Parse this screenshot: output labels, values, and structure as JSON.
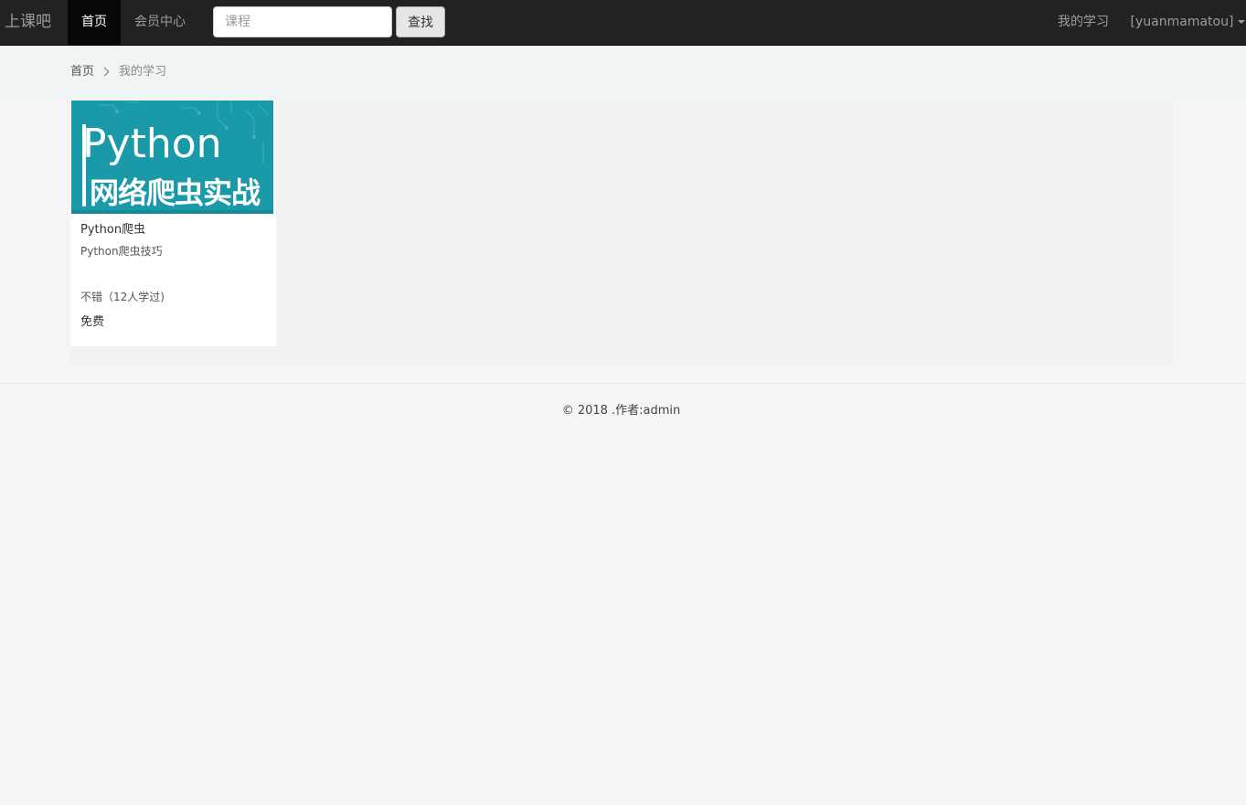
{
  "navbar": {
    "brand": "上课吧",
    "items": [
      {
        "label": "首页",
        "active": true
      },
      {
        "label": "会员中心",
        "active": false
      }
    ],
    "search": {
      "placeholder": "课程",
      "value": "",
      "button_label": "查找"
    },
    "right": {
      "my_learning": "我的学习",
      "user_menu": "[yuanmamatou]"
    }
  },
  "breadcrumb": {
    "home": "首页",
    "current": "我的学习"
  },
  "courses": [
    {
      "cover_title": "Python",
      "cover_subtitle": "网络爬虫实战",
      "name": "Python爬虫",
      "description": "Python爬虫技巧",
      "rating": "不错（12人学过)",
      "price": "免费"
    }
  ],
  "footer": {
    "text": "© 2018 .作者:admin"
  },
  "colors": {
    "navbar_bg": "#222222",
    "nav_active_bg": "#080808",
    "cover_bg": "#1a9aa8",
    "page_bg": "#f5f5f5"
  }
}
